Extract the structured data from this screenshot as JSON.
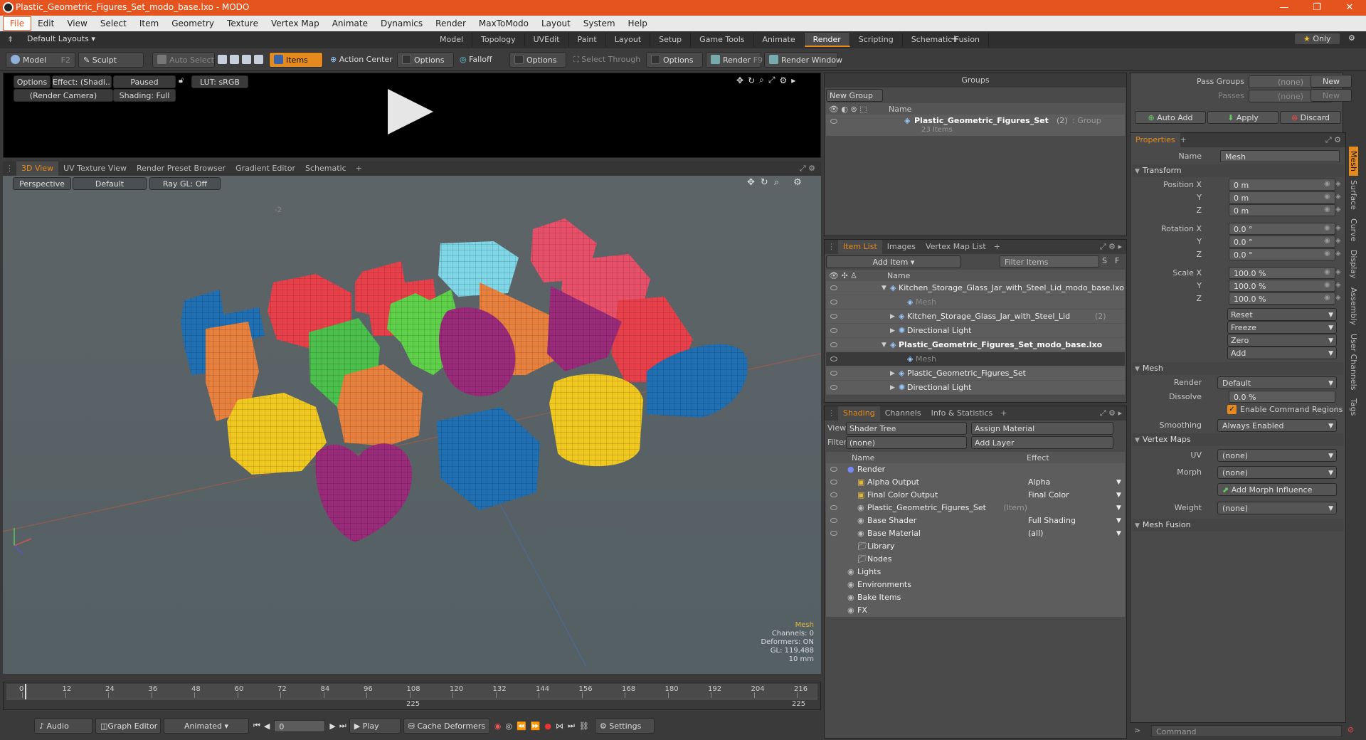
{
  "window": {
    "title": "Plastic_Geometric_Figures_Set_modo_base.lxo - MODO"
  },
  "menu": [
    "File",
    "Edit",
    "View",
    "Select",
    "Item",
    "Geometry",
    "Texture",
    "Vertex Map",
    "Animate",
    "Dynamics",
    "Render",
    "MaxToModo",
    "Layout",
    "System",
    "Help"
  ],
  "layoutbar": {
    "layouts_label": "Default Layouts",
    "tabs": [
      "Model",
      "Topology",
      "UVEdit",
      "Paint",
      "Layout",
      "Setup",
      "Game Tools",
      "Animate",
      "Render",
      "Scripting",
      "Schematic Fusion"
    ],
    "active": "Render",
    "only": "Only"
  },
  "toolbar": {
    "model": "Model",
    "model_key": "F2",
    "sculpt": "Sculpt",
    "auto_select": "Auto Select",
    "items": "Items",
    "action_center": "Action Center",
    "options1": "Options",
    "falloff": "Falloff",
    "options2": "Options",
    "select_through": "Select Through",
    "options3": "Options",
    "render": "Render",
    "render_key": "F9",
    "render_window": "Render Window"
  },
  "preview": {
    "options": "Options",
    "effect": "Effect: (Shadi...",
    "paused": "Paused",
    "lut": "LUT: sRGB",
    "camera": "(Render Camera)",
    "shading": "Shading: Full"
  },
  "viewport_tabs": [
    "3D View",
    "UV Texture View",
    "Render Preset Browser",
    "Gradient Editor",
    "Schematic"
  ],
  "viewport": {
    "perspective": "Perspective",
    "default": "Default",
    "raygl": "Ray GL: Off",
    "stats": {
      "type": "Mesh",
      "channels": "Channels: 0",
      "deformers": "Deformers: ON",
      "gl": "GL: 119,488",
      "scale": "10 mm"
    },
    "marker": "-2"
  },
  "timeline": {
    "ticks": [
      "0",
      "12",
      "24",
      "36",
      "48",
      "60",
      "72",
      "84",
      "96",
      "108",
      "120",
      "132",
      "144",
      "156",
      "168",
      "180",
      "192",
      "204",
      "216"
    ],
    "end_labels": [
      "225",
      "225"
    ]
  },
  "bottombar": {
    "audio": "Audio",
    "graph_editor": "Graph Editor",
    "animated": "Animated",
    "frame": "0",
    "play": "Play",
    "cache": "Cache Deformers",
    "settings": "Settings"
  },
  "groups": {
    "title": "Groups",
    "new_group": "New Group",
    "col_name": "Name",
    "item_name": "Plastic_Geometric_Figures_Set",
    "item_count": "(2)",
    "item_type": ": Group",
    "item_sub": "23 Items"
  },
  "itemlist": {
    "tabs": [
      "Item List",
      "Images",
      "Vertex Map List"
    ],
    "add_item": "Add Item",
    "filter": "Filter Items",
    "col_name": "Name",
    "rows": [
      {
        "label": "Kitchen_Storage_Glass_Jar_with_Steel_Lid_modo_base.lxo",
        "indent": 0,
        "bold": false,
        "dim": false
      },
      {
        "label": "Mesh",
        "indent": 2,
        "bold": false,
        "dim": true
      },
      {
        "label": "Kitchen_Storage_Glass_Jar_with_Steel_Lid",
        "extra": "(2)",
        "indent": 1,
        "bold": false,
        "dim": false
      },
      {
        "label": "Directional Light",
        "indent": 1,
        "bold": false,
        "dim": false
      },
      {
        "label": "Plastic_Geometric_Figures_Set_modo_base.lxo",
        "indent": 0,
        "bold": true,
        "dim": false
      },
      {
        "label": "Mesh",
        "indent": 2,
        "bold": false,
        "dim": true
      },
      {
        "label": "Plastic_Geometric_Figures_Set",
        "indent": 1,
        "bold": false,
        "dim": false
      },
      {
        "label": "Directional Light",
        "indent": 1,
        "bold": false,
        "dim": false
      }
    ]
  },
  "shading": {
    "tabs": [
      "Shading",
      "Channels",
      "Info & Statistics"
    ],
    "view_label": "View",
    "view_value": "Shader Tree",
    "assign": "Assign Material",
    "filter_label": "Filter",
    "filter_value": "(none)",
    "add_layer": "Add Layer",
    "col_name": "Name",
    "col_effect": "Effect",
    "rows": [
      {
        "label": "Render",
        "effect": "",
        "indent": 0
      },
      {
        "label": "Alpha Output",
        "effect": "Alpha",
        "indent": 1
      },
      {
        "label": "Final Color Output",
        "effect": "Final Color",
        "indent": 1
      },
      {
        "label": "Plastic_Geometric_Figures_Set",
        "extra": "(Item)",
        "effect": "",
        "indent": 1
      },
      {
        "label": "Base Shader",
        "effect": "Full Shading",
        "indent": 1
      },
      {
        "label": "Base Material",
        "effect": "(all)",
        "indent": 1
      },
      {
        "label": "Library",
        "effect": "",
        "indent": 1
      },
      {
        "label": "Nodes",
        "effect": "",
        "indent": 1
      },
      {
        "label": "Lights",
        "effect": "",
        "indent": 0
      },
      {
        "label": "Environments",
        "effect": "",
        "indent": 0
      },
      {
        "label": "Bake Items",
        "effect": "",
        "indent": 0
      },
      {
        "label": "FX",
        "effect": "",
        "indent": 0
      }
    ]
  },
  "passes": {
    "pass_groups": "Pass Groups",
    "passes": "Passes",
    "none": "(none)",
    "new": "New",
    "auto_add": "Auto Add",
    "apply": "Apply",
    "discard": "Discard"
  },
  "properties": {
    "tab": "Properties",
    "name_label": "Name",
    "name_value": "Mesh",
    "transform": "Transform",
    "position_label": "Position X",
    "rotation_label": "Rotation X",
    "scale_label": "Scale X",
    "y": "Y",
    "z": "Z",
    "pos": [
      "0 m",
      "0 m",
      "0 m"
    ],
    "rot": [
      "0.0 °",
      "0.0 °",
      "0.0 °"
    ],
    "scl": [
      "100.0 %",
      "100.0 %",
      "100.0 %"
    ],
    "reset": "Reset",
    "freeze": "Freeze",
    "zero": "Zero",
    "add": "Add",
    "mesh": "Mesh",
    "render_label": "Render",
    "render_value": "Default",
    "dissolve_label": "Dissolve",
    "dissolve_value": "0.0 %",
    "enable_cmd": "Enable Command Regions",
    "smoothing_label": "Smoothing",
    "smoothing_value": "Always Enabled",
    "vertex_maps": "Vertex Maps",
    "uv_label": "UV",
    "uv_value": "(none)",
    "morph_label": "Morph",
    "morph_value": "(none)",
    "add_morph": "Add Morph Influence",
    "weight_label": "Weight",
    "weight_value": "(none)",
    "mesh_fusion": "Mesh Fusion"
  },
  "side_tabs": [
    "Mesh",
    "Surface",
    "Curve",
    "Display",
    "Assembly",
    "User Channels",
    "Tags"
  ],
  "command": {
    "placeholder": "Command"
  },
  "colors": {
    "accent": "#e58a1e",
    "title": "#e5541e"
  }
}
